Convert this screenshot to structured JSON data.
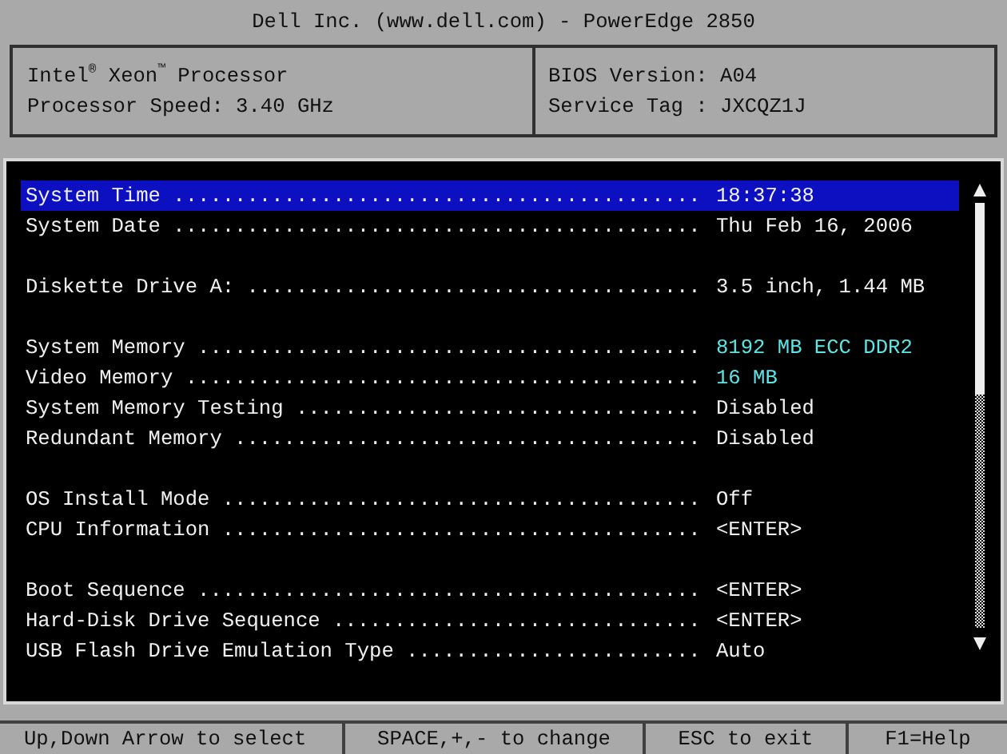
{
  "title": "Dell Inc. (www.dell.com) - PowerEdge 2850",
  "info": {
    "left": [
      "Intel$^{®}$ Xeon$^{™}$ Processor",
      "Processor Speed: 3.40 GHz"
    ],
    "right": [
      "BIOS Version: A04",
      "Service Tag : JXCQZ1J"
    ]
  },
  "groups": [
    [
      {
        "label": "System Time ...........................................",
        "value": "18:37:38",
        "kind": "setting",
        "selected": true
      },
      {
        "label": "System Date ...........................................",
        "value": "Thu Feb 16, 2006",
        "kind": "setting",
        "selected": false
      }
    ],
    [
      {
        "label": "Diskette Drive A: .....................................",
        "value": "3.5 inch, 1.44 MB",
        "kind": "setting",
        "selected": false
      }
    ],
    [
      {
        "label": "System Memory .........................................",
        "value": "8192 MB ECC DDR2",
        "kind": "info",
        "selected": false
      },
      {
        "label": "Video Memory ..........................................",
        "value": "16 MB",
        "kind": "info",
        "selected": false
      },
      {
        "label": "System Memory Testing .................................",
        "value": "Disabled",
        "kind": "setting",
        "selected": false
      },
      {
        "label": "Redundant Memory ......................................",
        "value": "Disabled",
        "kind": "setting",
        "selected": false
      }
    ],
    [
      {
        "label": "OS Install Mode .......................................",
        "value": "Off",
        "kind": "setting",
        "selected": false
      },
      {
        "label": "CPU Information .......................................",
        "value": "<ENTER>",
        "kind": "setting",
        "selected": false
      }
    ],
    [
      {
        "label": "Boot Sequence .........................................",
        "value": "<ENTER>",
        "kind": "setting",
        "selected": false
      },
      {
        "label": "Hard-Disk Drive Sequence ..............................",
        "value": "<ENTER>",
        "kind": "setting",
        "selected": false
      },
      {
        "label": "USB Flash Drive Emulation Type ........................",
        "value": "Auto",
        "kind": "setting",
        "selected": false
      }
    ]
  ],
  "footer": [
    "Up,Down Arrow to select",
    "SPACE,+,- to change",
    "ESC to exit",
    "F1=Help"
  ]
}
